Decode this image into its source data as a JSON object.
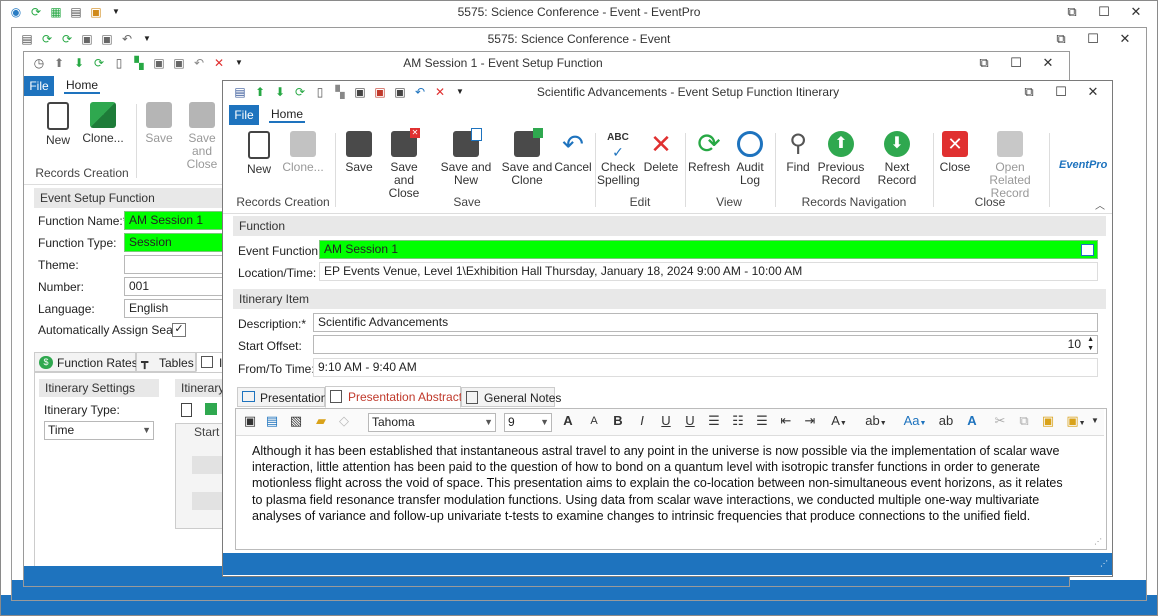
{
  "back_window": {
    "title": "5575: Science Conference - Event - EventPro"
  },
  "event_window": {
    "title": "5575: Science Conference - Event"
  },
  "function_window": {
    "title": "AM Session 1 - Event Setup Function",
    "tabs": {
      "file": "File",
      "home": "Home"
    },
    "ribbon": {
      "new": "New",
      "clone": "Clone...",
      "save": "Save",
      "save_and_close": "Save and Close",
      "group_records_creation": "Records Creation"
    },
    "section_title": "Event Setup Function",
    "fields": {
      "function_name_label": "Function Name:*",
      "function_name_value": "AM Session 1",
      "function_type_label": "Function Type:",
      "function_type_value": "Session",
      "theme_label": "Theme:",
      "theme_value": "",
      "number_label": "Number:",
      "number_value": "001",
      "language_label": "Language:",
      "language_value": "English",
      "auto_assign_label": "Automatically Assign Seats",
      "auto_assign_checked": "✓"
    },
    "subtabs": {
      "function_rates": "Function Rates",
      "tables": "Tables",
      "itinerary": "I"
    },
    "itinerary_settings": {
      "title": "Itinerary Settings",
      "type_label": "Itinerary Type:",
      "type_value": "Time",
      "list_title": "Itinerary",
      "grid_column": "Start O"
    }
  },
  "itinerary_window": {
    "title": "Scientific Advancements - Event Setup Function Itinerary",
    "tabs": {
      "file": "File",
      "home": "Home"
    },
    "ribbon": {
      "new": "New",
      "clone": "Clone...",
      "save": "Save",
      "save_and_close_1": "Save and",
      "save_and_close_2": "Close",
      "save_and_new": "Save and New",
      "save_and_clone_1": "Save and",
      "save_and_clone_2": "Clone",
      "cancel": "Cancel",
      "check_spelling_1": "Check",
      "check_spelling_2": "Spelling",
      "delete": "Delete",
      "refresh": "Refresh",
      "audit_log_1": "Audit",
      "audit_log_2": "Log",
      "find": "Find",
      "previous_record_1": "Previous",
      "previous_record_2": "Record",
      "next_record": "Next Record",
      "close": "Close",
      "open_related_1": "Open Related",
      "open_related_2": "Record",
      "logo": "EventPro",
      "groups": {
        "records_creation": "Records Creation",
        "save": "Save",
        "edit": "Edit",
        "view": "View",
        "records_navigation": "Records Navigation",
        "close": "Close"
      }
    },
    "function_section": {
      "title": "Function",
      "event_function_label": "Event Function:",
      "event_function_value": "AM Session 1",
      "location_label": "Location/Time:",
      "location_value": "EP Events Venue, Level 1\\Exhibition Hall Thursday, January 18, 2024 9:00 AM - 10:00 AM"
    },
    "itinerary_section": {
      "title": "Itinerary Item",
      "description_label": "Description:*",
      "description_value": "Scientific Advancements",
      "start_offset_label": "Start Offset:",
      "start_offset_value": "10",
      "from_to_label": "From/To Time:",
      "from_to_value": "9:10 AM - 9:40 AM"
    },
    "content_tabs": {
      "presentation": "Presentation",
      "presentation_abstract": "Presentation Abstract",
      "general_notes": "General Notes"
    },
    "editor": {
      "font": "Tahoma",
      "size": "9",
      "text": "Although it has been established that instantaneous astral travel to any point in the universe is now possible via the implementation of scalar wave interaction, little attention has been paid to the question of how to bond on a quantum level with isotropic transfer functions in order to generate motionless flight across the void of space. This presentation aims to explain the co-location between non-simultaneous event horizons, as it relates to plasma field resonance transfer modulation functions. Using data from scalar wave interactions, we conducted multiple one-way multivariate analyses of variance and follow-up univariate t-tests to examine changes to intrinsic frequencies that produce connections to the unified field."
    }
  },
  "colors": {
    "accent": "#1e73be",
    "highlight": "#00ff00",
    "active_tab": "#c0392b"
  }
}
